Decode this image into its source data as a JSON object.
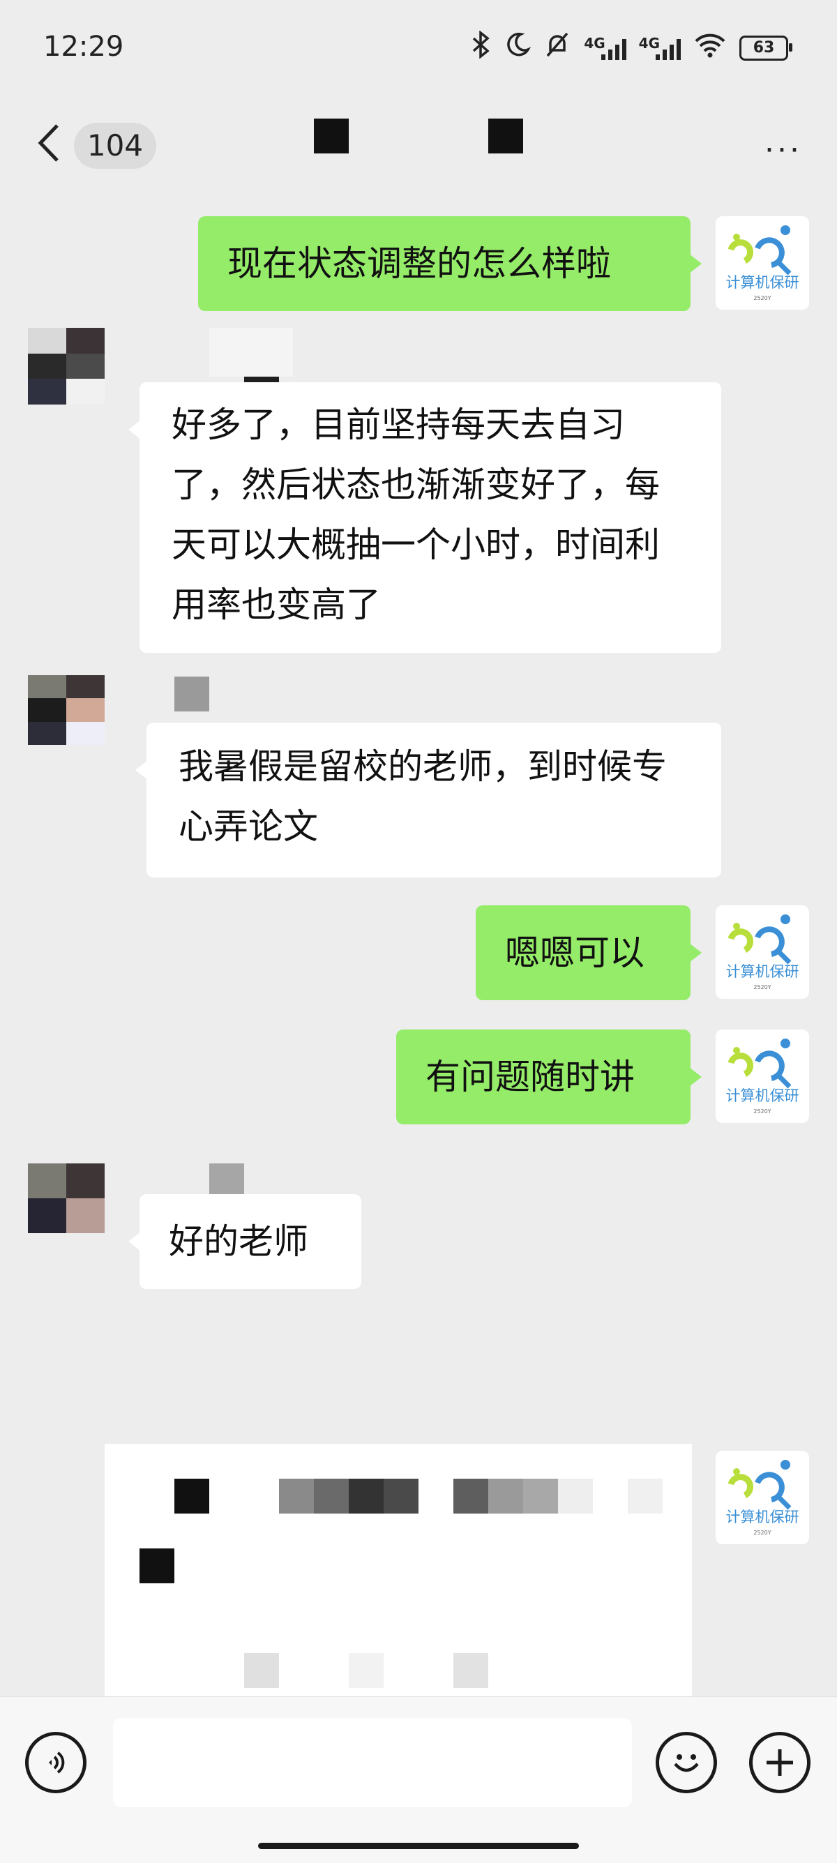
{
  "status_bar": {
    "time": "12:29",
    "net_a": "4G",
    "net_b": "4G",
    "battery": "63"
  },
  "nav": {
    "unread_count": "104",
    "more": "···"
  },
  "avatar_brand": "计算机保研",
  "avatar_brand_year": "2520Y",
  "messages": {
    "m1": "现在状态调整的怎么样啦",
    "m2": "好多了，目前坚持每天去自习了，然后状态也渐渐变好了，每天可以大概抽一个小时，时间利用率也变高了",
    "m3": "我暑假是留校的老师，到时候专心弄论文",
    "m4": "嗯嗯可以",
    "m5": "有问题随时讲",
    "m6": "好的老师"
  },
  "input": {
    "placeholder": ""
  },
  "icons": {
    "back": "chevron-left-icon",
    "more": "more-icon",
    "voice": "voice-icon",
    "emoji": "emoji-icon",
    "add": "plus-icon"
  },
  "colors": {
    "bg": "#ededed",
    "bubble_self": "#95ec69",
    "bubble_other": "#ffffff"
  }
}
